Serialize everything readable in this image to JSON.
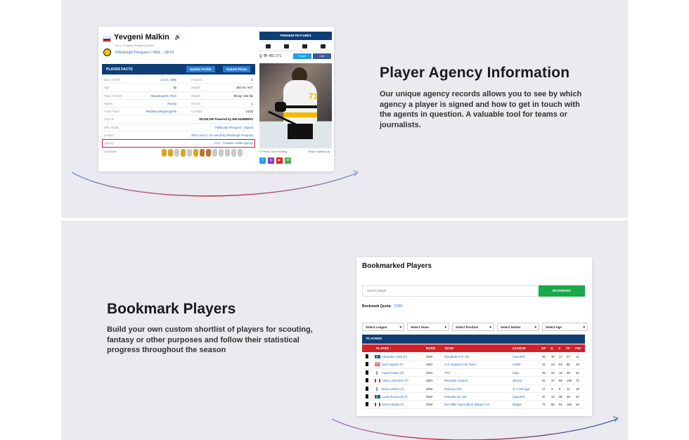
{
  "section1": {
    "heading": "Player Agency Information",
    "description": "Our unique agency records allows you to see by which agency a player is signed and how to get in touch with the agents in question. A valuable tool for teams or journalists."
  },
  "section2": {
    "heading": "Bookmark Players",
    "description": "Build your own custom shortlist of players for scouting, fantasy or other purposes and follow their statistical progress throughout the season"
  },
  "profile": {
    "name": "Yevgeni Malkin",
    "aka": "a.k.a. \"Evgeni, Sevgenij Malkin\"",
    "team_line": "Pittsburgh Penguins / NHL - 18/19",
    "facts_title": "PLAYER FACTS",
    "update_btn": "Update Profile",
    "submit_btn": "Submit Photo",
    "facts": [
      {
        "l1": "Date of Birth",
        "v1": "Jul 31, 1986",
        "l2": "Position",
        "v2": "C"
      },
      {
        "l1": "Age",
        "v1": "32",
        "l2": "Height",
        "v2": "192 cm / 6'4\""
      },
      {
        "l1": "Place of Birth",
        "v1": "Magnitogorsk, RUS",
        "l2": "Weight",
        "v2": "88 kg / 194 lbs"
      },
      {
        "l1": "Nation",
        "v1": "Russia",
        "l2": "Shoots",
        "v2": "L"
      },
      {
        "l1": "Youth Team",
        "v1": "Metallurg Magnitogorsk",
        "l2": "Contract",
        "v2": "21/22"
      }
    ],
    "cap_label": "Cap Hit",
    "cap_value": "$9,500,000 Powered by NHLNUMBERS",
    "rights_label": "NHL Rights",
    "rights_value": "Pittsburgh Penguins / Signed",
    "drafted_label": "Drafted",
    "drafted_value": "2004 round 1 #2 overall by Pittsburgh Penguins",
    "agency_label": "Agency",
    "agency_value": "CAA - Creative Artists Agency",
    "highlights_label": "Highlights",
    "premium_title": "PREMIUM FEATURES",
    "views": "482 271",
    "tweet": "Tweet",
    "like": "Like",
    "photo_credit": "© Photo: Dan Hickling",
    "gallery": "Player Gallery (6)",
    "jersey_number": "71"
  },
  "bookmarks": {
    "title": "Bookmarked Players",
    "search_placeholder": "Search player...",
    "bookmark_btn": "BOOKMARK",
    "quota_label": "Bookmark Quota:",
    "quota_value": "7/200",
    "filters": [
      "Select League",
      "Select Team",
      "Select Position",
      "Select Nation",
      "Select Age"
    ],
    "players_title": "PLAYERS",
    "columns": {
      "player": "PLAYER ↑",
      "born": "BORN",
      "team": "TEAM",
      "league": "LEAGUE",
      "gp": "GP",
      "g": "G",
      "a": "A",
      "tp": "TP",
      "pim": "PIM"
    },
    "rows": [
      {
        "player": "Alexander Holtz (F)",
        "born": "2002",
        "team": "Djurgårdens IF J20",
        "league": "SuperElit",
        "gp": "38",
        "g": "30",
        "a": "17",
        "tp": "47",
        "pim": "12",
        "flag": "se"
      },
      {
        "player": "Jack Hughes (F)",
        "born": "2001",
        "team": "U.S. National U18 Team",
        "league": "USDP",
        "gp": "41",
        "g": "23",
        "a": "63",
        "tp": "86",
        "pim": "18",
        "flag": "us"
      },
      {
        "player": "Kaapo Kakko (F)",
        "born": "2001",
        "team": "TPS",
        "league": "Liiga",
        "gp": "45",
        "g": "22",
        "a": "16",
        "tp": "38",
        "pim": "10",
        "flag": "fi"
      },
      {
        "player": "Alexis Lafrenière (F)",
        "born": "2001",
        "team": "Rimouski Océanic",
        "league": "QMJHL",
        "gp": "61",
        "g": "37",
        "a": "68",
        "tp": "105",
        "pim": "72",
        "flag": "ca"
      },
      {
        "player": "Brad Lambert (F)",
        "born": "2003",
        "team": "Pelicans U20",
        "league": "Jr. A SM-liiga",
        "gp": "17",
        "g": "2",
        "a": "9",
        "tp": "11",
        "pim": "18",
        "flag": "fi"
      },
      {
        "player": "Lucas Raymond (F)",
        "born": "2002",
        "team": "Frölunda HC J20",
        "league": "SuperElit",
        "gp": "37",
        "g": "13",
        "a": "35",
        "tp": "48",
        "pim": "24",
        "flag": "se"
      },
      {
        "player": "Shane Wright (F)",
        "born": "2004",
        "team": "Don Mills Flyers Minor Midget AAA",
        "league": "Midget",
        "gp": "72",
        "g": "66",
        "a": "84",
        "tp": "150",
        "pim": "16",
        "flag": "ca"
      }
    ]
  },
  "colors": {
    "navy": "#0f3e75",
    "red": "#d0212b",
    "green": "#1aa84a",
    "link": "#2a6db5"
  }
}
